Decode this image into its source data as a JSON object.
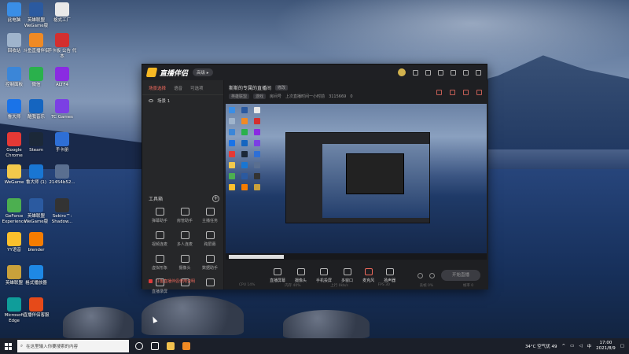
{
  "desktop_icons": [
    {
      "label": "此电脑",
      "color": "#3a8ee6"
    },
    {
      "label": "英雄联盟 WeGame版",
      "color": "#2b5aa0"
    },
    {
      "label": "格式工厂",
      "color": "#e9e9e9"
    },
    {
      "label": "回收站",
      "color": "#9fb4cc"
    },
    {
      "label": "斗鱼直播伴侣",
      "color": "#f08a24"
    },
    {
      "label": "手卡板 公告 代本",
      "color": "#d32f2f"
    },
    {
      "label": "控制面板",
      "color": "#3b86d8"
    },
    {
      "label": "微信",
      "color": "#2ab14c"
    },
    {
      "label": "ALTF4",
      "color": "#8a2be2"
    },
    {
      "label": "鲁大师",
      "color": "#1a73e8"
    },
    {
      "label": "酷我音乐",
      "color": "#1565c0"
    },
    {
      "label": "TC Games",
      "color": "#7b3fe4"
    },
    {
      "label": "Google Chrome",
      "color": "#e53935"
    },
    {
      "label": "Steam",
      "color": "#1b2838"
    },
    {
      "label": "手卡册",
      "color": "#2e6fd6"
    },
    {
      "label": "WeGame",
      "color": "#f2c94c"
    },
    {
      "label": "鲁大师 (1)",
      "color": "#1976d2"
    },
    {
      "label": "21454b52...",
      "color": "#5a6f90"
    },
    {
      "label": "GeForce Experience",
      "color": "#4caf50"
    },
    {
      "label": "英雄联盟 WeGame版",
      "color": "#2b5aa0"
    },
    {
      "label": "Sekiro™: Shadow...",
      "color": "#333"
    },
    {
      "label": "YY语音",
      "color": "#fbc02d"
    },
    {
      "label": "blender",
      "color": "#f57c00"
    },
    {
      "label": "英雄联盟",
      "color": "#c9a13b"
    },
    {
      "label": "格式播放器",
      "color": "#1e88e5"
    },
    {
      "label": "Microsoft Edge",
      "color": "#0f9d9a"
    },
    {
      "label": "直播伴侣客服",
      "color": "#e64a19"
    }
  ],
  "app": {
    "logo_text": "直播伴侣",
    "badge": "高级 ▸",
    "tabs": [
      "场景选择",
      "语音",
      "可选项"
    ],
    "scene_name": "场景 1",
    "tools_title": "工具箱",
    "tools": [
      {
        "label": "弹幕助手"
      },
      {
        "label": "房管助手"
      },
      {
        "label": "主播任务"
      },
      {
        "label": "视频连麦"
      },
      {
        "label": "多人连麦"
      },
      {
        "label": "跨屏幕"
      },
      {
        "label": "虚拟形象"
      },
      {
        "label": "摄像头"
      },
      {
        "label": "数据助手"
      },
      {
        "label": "直播录屏"
      },
      {
        "label": ""
      },
      {
        "label": ""
      }
    ],
    "tip": "斗鱼直播伴侣使用说明",
    "room_title": "斯斯的专属的直播间",
    "edit_label": "修改",
    "meta": [
      "英雄联盟",
      "游戏",
      "房间号",
      "上次直播时间一小时前",
      "3115669",
      "0"
    ],
    "controls": [
      {
        "label": "直播屏幕"
      },
      {
        "label": "摄像头"
      },
      {
        "label": "手机投屏"
      },
      {
        "label": "多窗口"
      },
      {
        "label": "麦克风"
      },
      {
        "label": "扬声器"
      }
    ],
    "go_live": "开始直播",
    "status": [
      "CPU 14%",
      "内存 40%",
      "上行 0kb/s",
      "FPS 30",
      "丢帧 0%",
      "帧率 0"
    ]
  },
  "taskbar": {
    "search_placeholder": "在这里输入你要搜索的内容",
    "weather": "34°C 空气优 49",
    "time": "17:00",
    "date": "2021/8/9"
  }
}
